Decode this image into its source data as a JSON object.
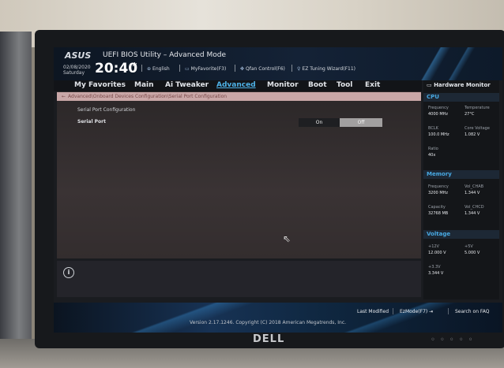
{
  "bios": {
    "logo": "ASUS",
    "title": "UEFI BIOS Utility – Advanced Mode",
    "date_line1": "02/08/2020",
    "date_line2": "Saturday",
    "time": "20:40",
    "toolbar": [
      {
        "icon": "globe-icon",
        "label": "English"
      },
      {
        "icon": "favorites-icon",
        "label": "MyFavorite(F3)"
      },
      {
        "icon": "fan-icon",
        "label": "Qfan Control(F6)"
      },
      {
        "icon": "bulb-icon",
        "label": "EZ Tuning Wizard(F11)"
      }
    ],
    "menu": [
      "My Favorites",
      "Main",
      "Ai Tweaker",
      "Advanced",
      "Monitor",
      "Boot",
      "Tool",
      "Exit"
    ],
    "active_menu": "Advanced",
    "breadcrumb": "Advanced\\Onboard Devices Configuration\\Serial Port Configuration",
    "section_title": "Serial Port Configuration",
    "setting": {
      "label": "Serial Port",
      "on_label": "On",
      "off_label": "Off",
      "selected": "On"
    }
  },
  "hardware_monitor": {
    "title": "Hardware Monitor",
    "cpu": {
      "heading": "CPU",
      "frequency_label": "Frequency",
      "frequency": "4000 MHz",
      "temperature_label": "Temperature",
      "temperature": "27°C",
      "bclk_label": "BCLK",
      "bclk": "100.0 MHz",
      "core_voltage_label": "Core Voltage",
      "core_voltage": "1.082 V",
      "ratio_label": "Ratio",
      "ratio": "40x"
    },
    "memory": {
      "heading": "Memory",
      "frequency_label": "Frequency",
      "frequency": "3200 MHz",
      "vol_chab_label": "Vol_CHAB",
      "vol_chab": "1.344 V",
      "capacity_label": "Capacity",
      "capacity": "32768 MB",
      "vol_chcd_label": "Vol_CHCD",
      "vol_chcd": "1.344 V"
    },
    "voltage": {
      "heading": "Voltage",
      "v12_label": "+12V",
      "v12": "12.000 V",
      "v5_label": "+5V",
      "v5": "5.000 V",
      "v33_label": "+3.3V",
      "v33": "3.344 V"
    }
  },
  "footer": {
    "last_modified": "Last Modified",
    "ezmode": "EzMode(F7)",
    "search": "Search on FAQ",
    "version": "Version 2.17.1246. Copyright (C) 2018 American Megatrends, Inc."
  },
  "monitor_brand": "DELL"
}
